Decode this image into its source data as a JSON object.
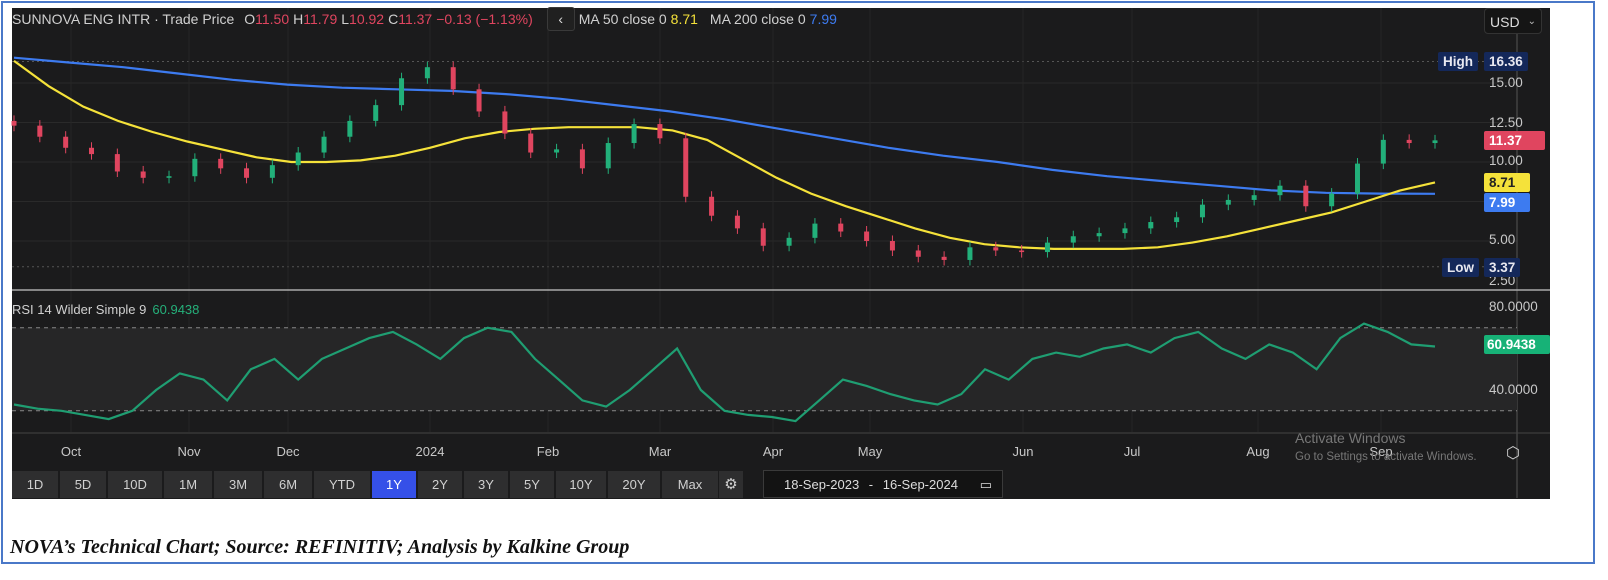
{
  "legend": {
    "instrument": "SUNNOVA ENG INTR · Trade Price",
    "o_label": "O",
    "o_value": "11.50",
    "h_label": "H",
    "h_value": "11.79",
    "l_label": "L",
    "l_value": "10.92",
    "c_label": "C",
    "c_value": "11.37",
    "change": "−0.13 (−1.13%)",
    "collapse_icon": "‹",
    "ma50_label": "MA 50 close 0",
    "ma50_value": "8.71",
    "ma200_label": "MA 200 close 0",
    "ma200_value": "7.99"
  },
  "currency": {
    "selected": "USD",
    "icon": "⌄"
  },
  "price_axis": {
    "ticks": [
      "15.00",
      "12.50",
      "10.00",
      "5.00",
      "2.50"
    ],
    "high_label": "High",
    "high_value": "16.36",
    "low_label": "Low",
    "low_value": "3.37",
    "last_price": "11.37",
    "ma50_tag": "8.71",
    "ma200_tag": "7.99"
  },
  "rsi": {
    "label": "RSI 14 Wilder Simple 9",
    "value": "60.9438",
    "ticks": [
      "80.0000",
      "40.0000"
    ]
  },
  "time_axis": [
    "Oct",
    "Nov",
    "Dec",
    "2024",
    "Feb",
    "Mar",
    "Apr",
    "May",
    "Jun",
    "Jul",
    "Aug",
    "Sep"
  ],
  "range_buttons": [
    {
      "label": "1D"
    },
    {
      "label": "5D"
    },
    {
      "label": "10D"
    },
    {
      "label": "1M"
    },
    {
      "label": "3M"
    },
    {
      "label": "6M"
    },
    {
      "label": "YTD"
    },
    {
      "label": "1Y",
      "active": true
    },
    {
      "label": "2Y"
    },
    {
      "label": "3Y"
    },
    {
      "label": "5Y"
    },
    {
      "label": "10Y"
    },
    {
      "label": "20Y"
    },
    {
      "label": "Max"
    }
  ],
  "date_range": {
    "from": "18-Sep-2023",
    "sep": "-",
    "to": "16-Sep-2024"
  },
  "watermark": {
    "line1": "Activate Windows",
    "line2": "Go to Settings to activate Windows."
  },
  "caption": "NOVA’s Technical Chart; Source: REFINITIV; Analysis by Kalkine Group",
  "colors": {
    "up": "#22b07a",
    "down": "#e0455f",
    "ma50": "#f5e23a",
    "ma200": "#3d7bf0",
    "rsi": "#1f9e72"
  },
  "chart_data": {
    "type": "line",
    "title": "SUNNOVA ENG INTR · Trade Price",
    "period": "18-Sep-2023 to 16-Sep-2024",
    "ylim": [
      2.2,
      17.2
    ],
    "weekly_close": [
      12.3,
      11.6,
      10.9,
      10.5,
      9.4,
      9.0,
      9.1,
      10.2,
      9.6,
      9.0,
      9.8,
      10.6,
      11.6,
      12.6,
      13.6,
      15.3,
      16.0,
      14.6,
      13.2,
      11.8,
      10.6,
      10.8,
      9.6,
      11.2,
      12.4,
      11.5,
      7.8,
      6.6,
      5.8,
      4.7,
      5.2,
      6.1,
      5.6,
      5.0,
      4.4,
      4.0,
      3.8,
      4.6,
      4.4,
      4.3,
      4.9,
      5.3,
      5.5,
      5.8,
      6.2,
      6.5,
      7.3,
      7.6,
      7.9,
      8.5,
      7.2,
      8.0,
      9.9,
      11.4,
      11.2,
      11.37
    ],
    "ma50": [
      16.4,
      14.8,
      13.5,
      12.6,
      11.9,
      11.3,
      10.8,
      10.3,
      10.0,
      10.0,
      10.1,
      10.4,
      10.9,
      11.5,
      11.9,
      12.1,
      12.2,
      12.2,
      12.2,
      12.0,
      11.4,
      10.2,
      9.0,
      8.0,
      7.2,
      6.5,
      5.8,
      5.2,
      4.8,
      4.6,
      4.5,
      4.5,
      4.5,
      4.6,
      4.9,
      5.3,
      5.8,
      6.3,
      6.8,
      7.5,
      8.2,
      8.71
    ],
    "ma200": [
      16.6,
      16.3,
      16.0,
      15.6,
      15.2,
      14.9,
      14.7,
      14.6,
      14.5,
      14.3,
      14.0,
      13.6,
      13.2,
      12.7,
      12.1,
      11.5,
      10.9,
      10.4,
      10.0,
      9.5,
      9.1,
      8.8,
      8.5,
      8.2,
      8.05,
      8.0,
      7.99
    ],
    "rsi_ylim": [
      20,
      85
    ],
    "rsi_bands": [
      30,
      70
    ],
    "rsi": [
      33,
      31,
      30,
      28,
      26,
      30,
      40,
      48,
      45,
      35,
      50,
      55,
      45,
      55,
      60,
      65,
      68,
      62,
      55,
      65,
      70,
      68,
      55,
      45,
      35,
      32,
      40,
      50,
      60,
      40,
      30,
      28,
      27,
      25,
      35,
      45,
      42,
      38,
      35,
      33,
      38,
      50,
      45,
      55,
      58,
      56,
      60,
      62,
      58,
      65,
      68,
      60,
      55,
      62,
      58,
      50,
      65,
      72,
      68,
      62,
      60.94
    ]
  }
}
